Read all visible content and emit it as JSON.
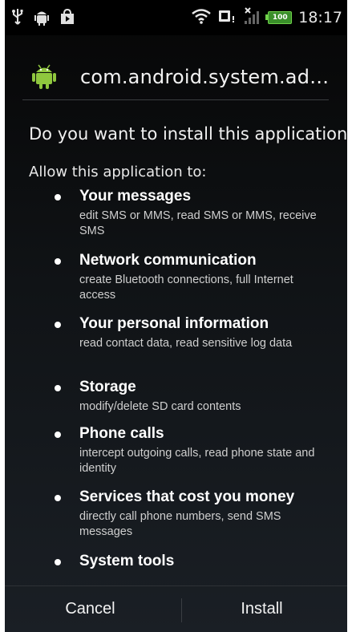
{
  "status_bar": {
    "time": "18:17",
    "battery_level": "100"
  },
  "header": {
    "app_name": "com.android.system.ad…"
  },
  "question": "Do you want to install this application?",
  "allow_heading": "Allow this application to:",
  "permissions": [
    {
      "title": "Your messages",
      "desc": "edit SMS or MMS, read SMS or MMS, receive SMS"
    },
    {
      "title": "Network communication",
      "desc": "create Bluetooth connections, full Internet access"
    },
    {
      "title": "Your personal information",
      "desc": "read contact data, read sensitive log data"
    },
    {
      "title": "Storage",
      "desc": "modify/delete SD card contents"
    },
    {
      "title": "Phone calls",
      "desc": "intercept outgoing calls, read phone state and identity"
    },
    {
      "title": "Services that cost you money",
      "desc": "directly call phone numbers, send SMS messages"
    },
    {
      "title": "System tools",
      "desc": ""
    }
  ],
  "buttons": {
    "cancel": "Cancel",
    "install": "Install"
  },
  "colors": {
    "android_green": "#8fc73e",
    "battery_green": "#6fd14a"
  }
}
